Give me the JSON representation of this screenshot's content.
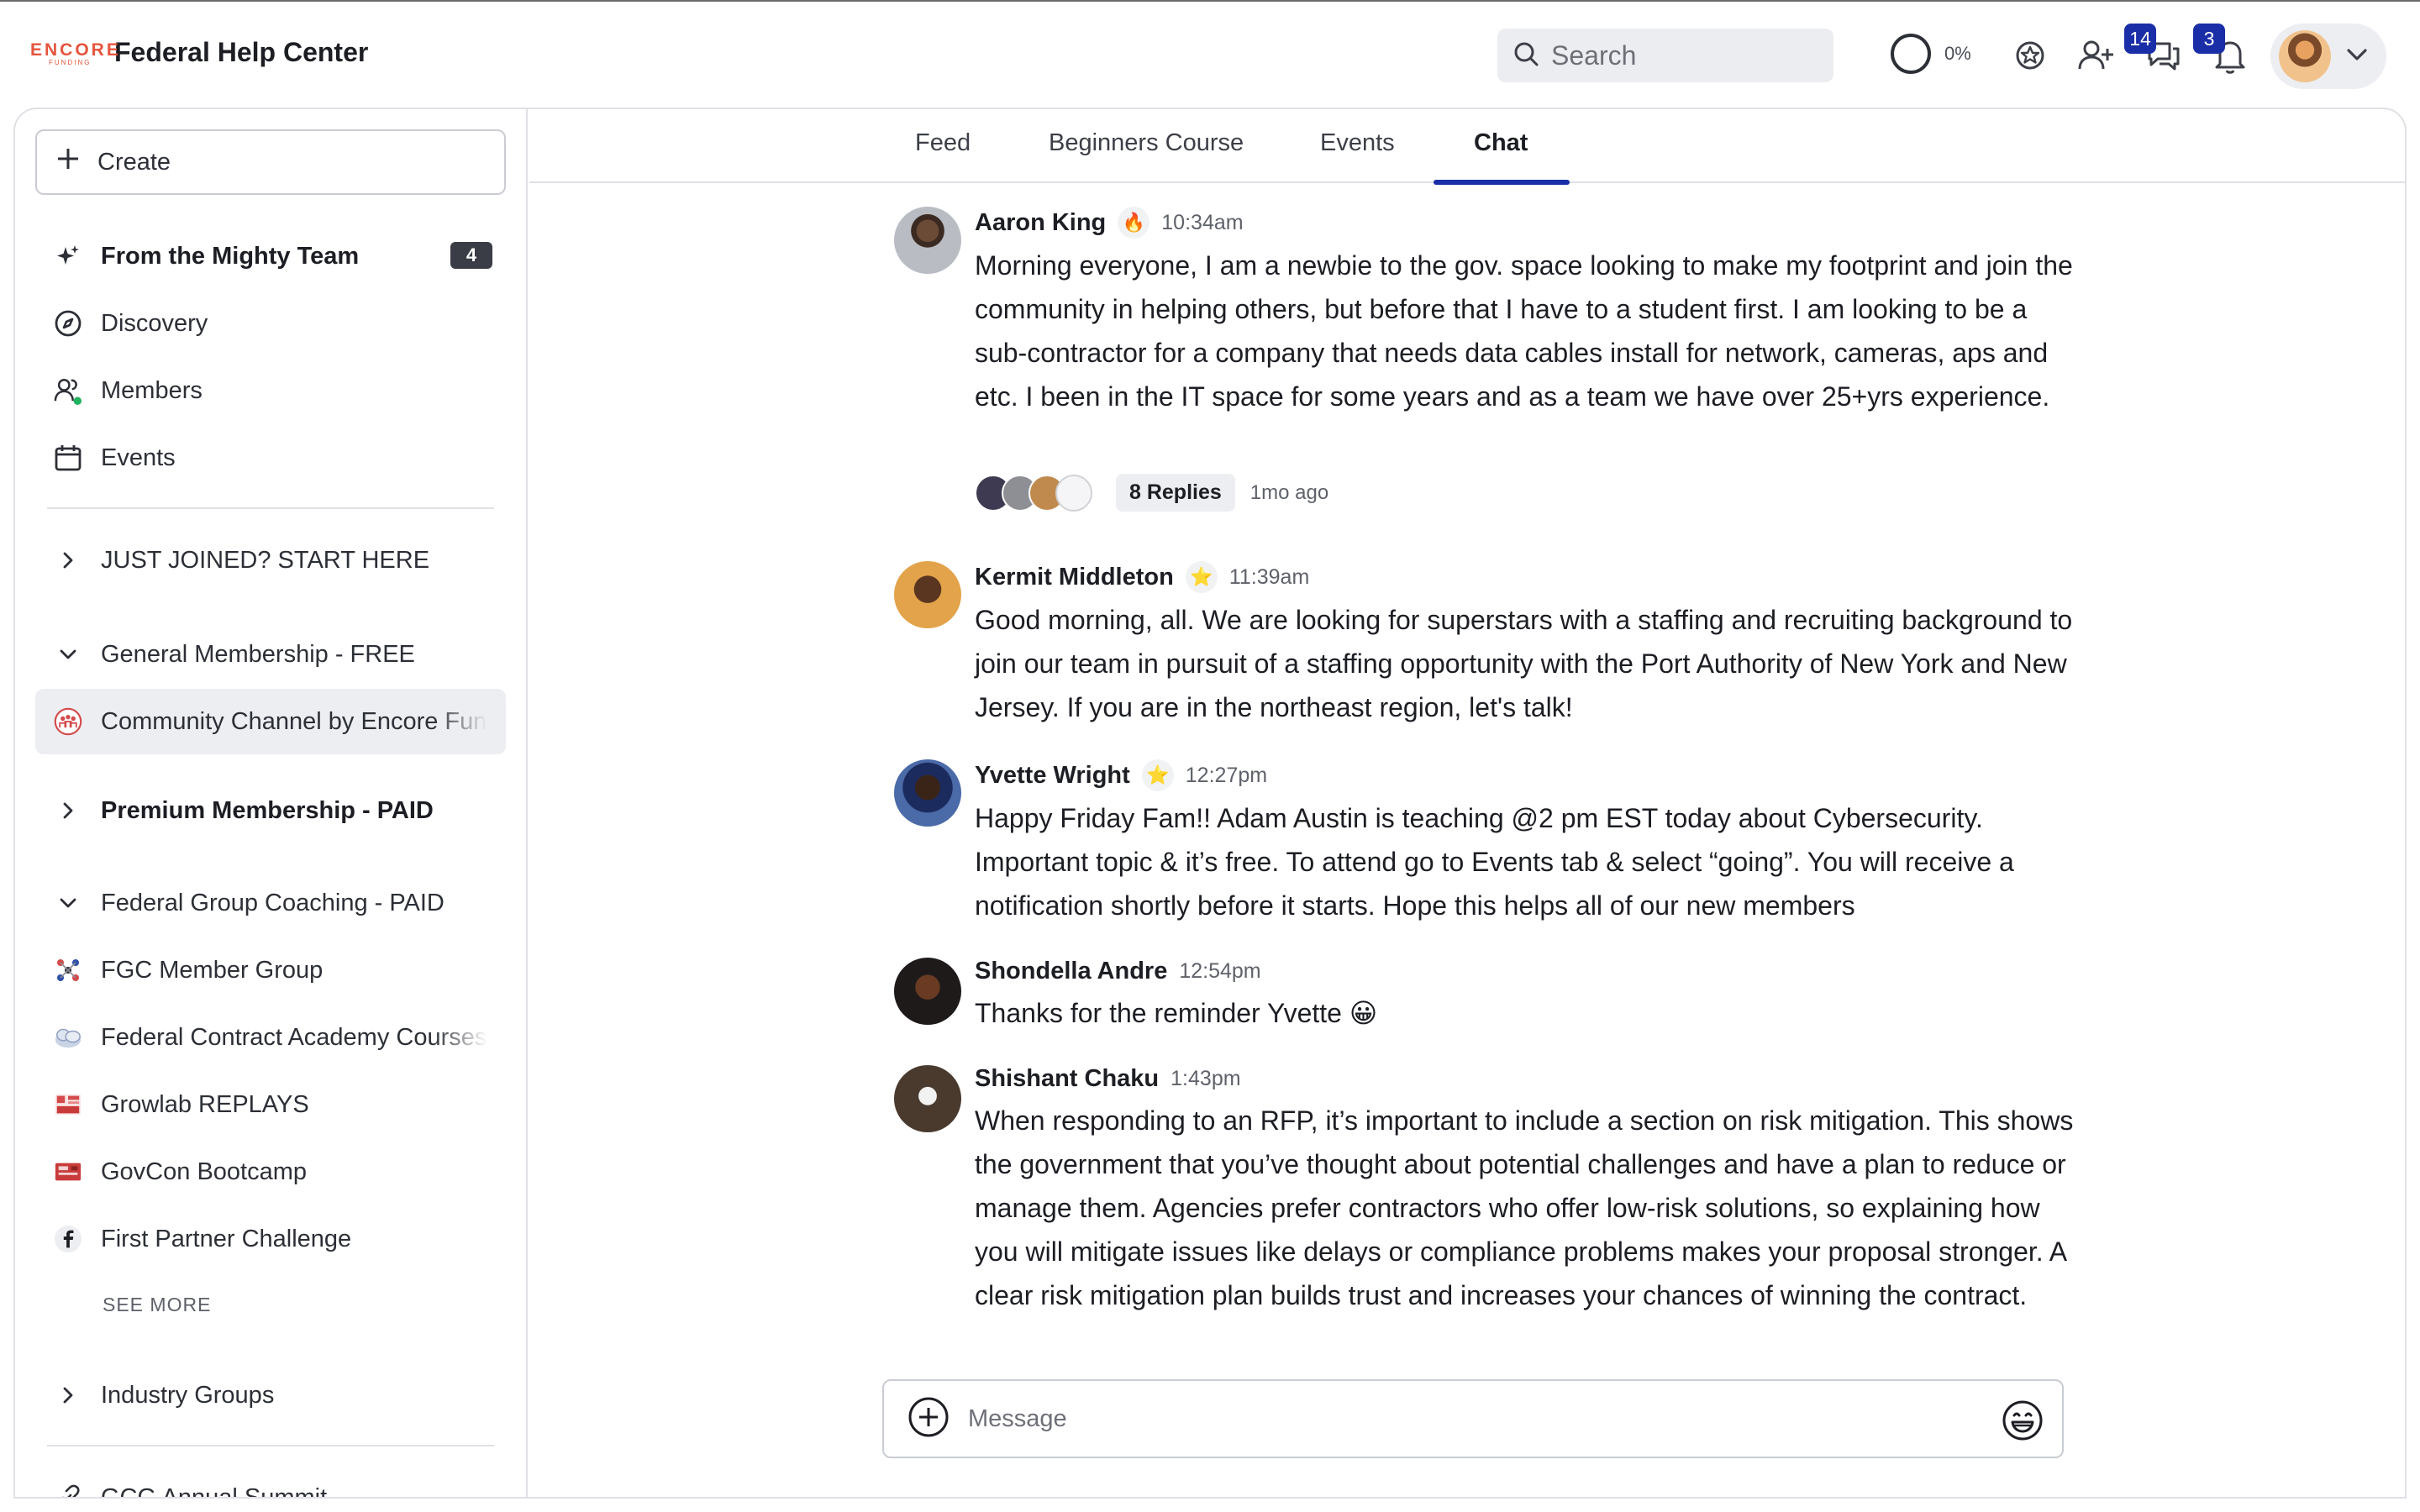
{
  "brand": {
    "logo_text": "ENCORE",
    "logo_sub": "FUNDING",
    "name": "Federal Help Center"
  },
  "topbar": {
    "search_placeholder": "Search",
    "progress": "0%",
    "messages_badge": "14",
    "notifications_badge": "3"
  },
  "sidebar": {
    "create_label": "Create",
    "items": [
      {
        "label": "From the Mighty Team",
        "count": "4"
      },
      {
        "label": "Discovery"
      },
      {
        "label": "Members"
      },
      {
        "label": "Events"
      }
    ],
    "groups": [
      {
        "label": "JUST JOINED? START HERE"
      },
      {
        "label": "General Membership - FREE"
      },
      {
        "label": "Community Channel by Encore Funding"
      },
      {
        "label": "Premium Membership - PAID"
      },
      {
        "label": "Federal Group Coaching - PAID"
      },
      {
        "label": "FGC Member Group"
      },
      {
        "label": "Federal Contract Academy Courses"
      },
      {
        "label": "Growlab REPLAYS"
      },
      {
        "label": "GovCon Bootcamp"
      },
      {
        "label": "First Partner Challenge"
      },
      {
        "label": "SEE MORE"
      },
      {
        "label": "Industry Groups"
      },
      {
        "label": "GCG Annual Summit"
      }
    ]
  },
  "tabs": [
    {
      "label": "Feed"
    },
    {
      "label": "Beginners Course"
    },
    {
      "label": "Events"
    },
    {
      "label": "Chat"
    }
  ],
  "messages": [
    {
      "name": "Aaron King",
      "time": "10:34am",
      "text": "Morning everyone, I am a newbie to the gov. space looking to make my footprint and join the community in helping others, but before that I have to a student first. I am looking to be a sub-contractor for a company that needs data cables install for network, cameras, aps and etc. I been in the IT space for some years and as a team we have over 25+yrs experience.",
      "replies": "8 Replies",
      "replies_age": "1mo ago"
    },
    {
      "name": "Kermit Middleton",
      "time": "11:39am",
      "text": "Good morning, all. We are looking for superstars with a staffing and recruiting background to join our team in pursuit of a staffing opportunity with the Port Authority of New York and New Jersey. If you are in the northeast region, let's talk!"
    },
    {
      "name": "Yvette Wright",
      "time": "12:27pm",
      "text": "Happy Friday Fam!! Adam Austin is teaching @2 pm EST today about Cybersecurity. Important topic & it’s free. To attend go to Events tab & select “going”. You will receive a notification shortly before it starts. Hope this helps all of our new members"
    },
    {
      "name": "Shondella Andre",
      "time": "12:54pm",
      "text": "Thanks for the reminder Yvette 😀"
    },
    {
      "name": "Shishant Chaku",
      "time": "1:43pm",
      "text": "When responding to an RFP, it’s important to include a section on risk mitigation. This shows the government that you’ve thought about potential challenges and have a plan to reduce or manage them. Agencies prefer contractors who offer low-risk solutions, so explaining how you will mitigate issues like delays or compliance problems makes your proposal stronger. A clear risk mitigation plan builds trust and increases your chances of winning the contract."
    }
  ],
  "composer": {
    "placeholder": "Message"
  },
  "colors": {
    "accent": "#1a2ea8",
    "brand": "#e5553d",
    "active_bg": "#eceef2",
    "online": "#22b35e"
  }
}
